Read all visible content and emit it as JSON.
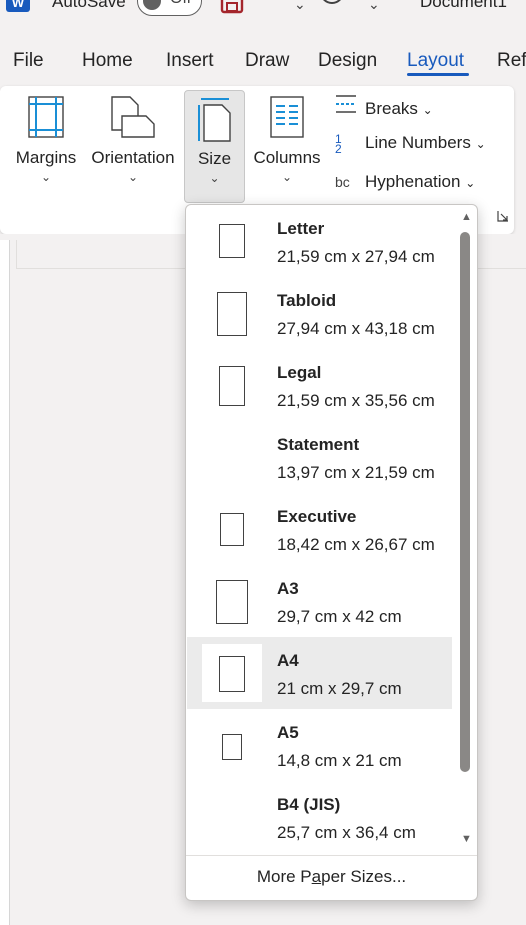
{
  "titlebar": {
    "autosave_label": "AutoSave",
    "autosave_state": "Off",
    "document_title": "Document1"
  },
  "tabs": [
    {
      "label": "File"
    },
    {
      "label": "Home"
    },
    {
      "label": "Insert"
    },
    {
      "label": "Draw"
    },
    {
      "label": "Design"
    },
    {
      "label": "Layout",
      "active": true
    },
    {
      "label": "Ref"
    }
  ],
  "ribbon": {
    "margins_label": "Margins",
    "orientation_label": "Orientation",
    "size_label": "Size",
    "columns_label": "Columns",
    "breaks_label": "Breaks",
    "line_numbers_label": "Line Numbers",
    "hyphenation_label": "Hyphenation"
  },
  "size_menu": {
    "items": [
      {
        "name": "Letter",
        "dims": "21,59 cm x 27,94 cm"
      },
      {
        "name": "Tabloid",
        "dims": "27,94 cm x 43,18 cm"
      },
      {
        "name": "Legal",
        "dims": "21,59 cm x 35,56 cm"
      },
      {
        "name": "Statement",
        "dims": "13,97 cm x 21,59 cm"
      },
      {
        "name": "Executive",
        "dims": "18,42 cm x 26,67 cm"
      },
      {
        "name": "A3",
        "dims": "29,7 cm x 42 cm"
      },
      {
        "name": "A4",
        "dims": "21 cm x 29,7 cm",
        "selected": true
      },
      {
        "name": "A5",
        "dims": "14,8 cm x 21 cm"
      },
      {
        "name": "B4 (JIS)",
        "dims": "25,7 cm x 36,4 cm"
      }
    ],
    "more_label_pre": "More P",
    "more_label_accel": "a",
    "more_label_post": "per Sizes..."
  },
  "colors": {
    "accent": "#185abd",
    "selected_bg": "#ebebeb"
  }
}
